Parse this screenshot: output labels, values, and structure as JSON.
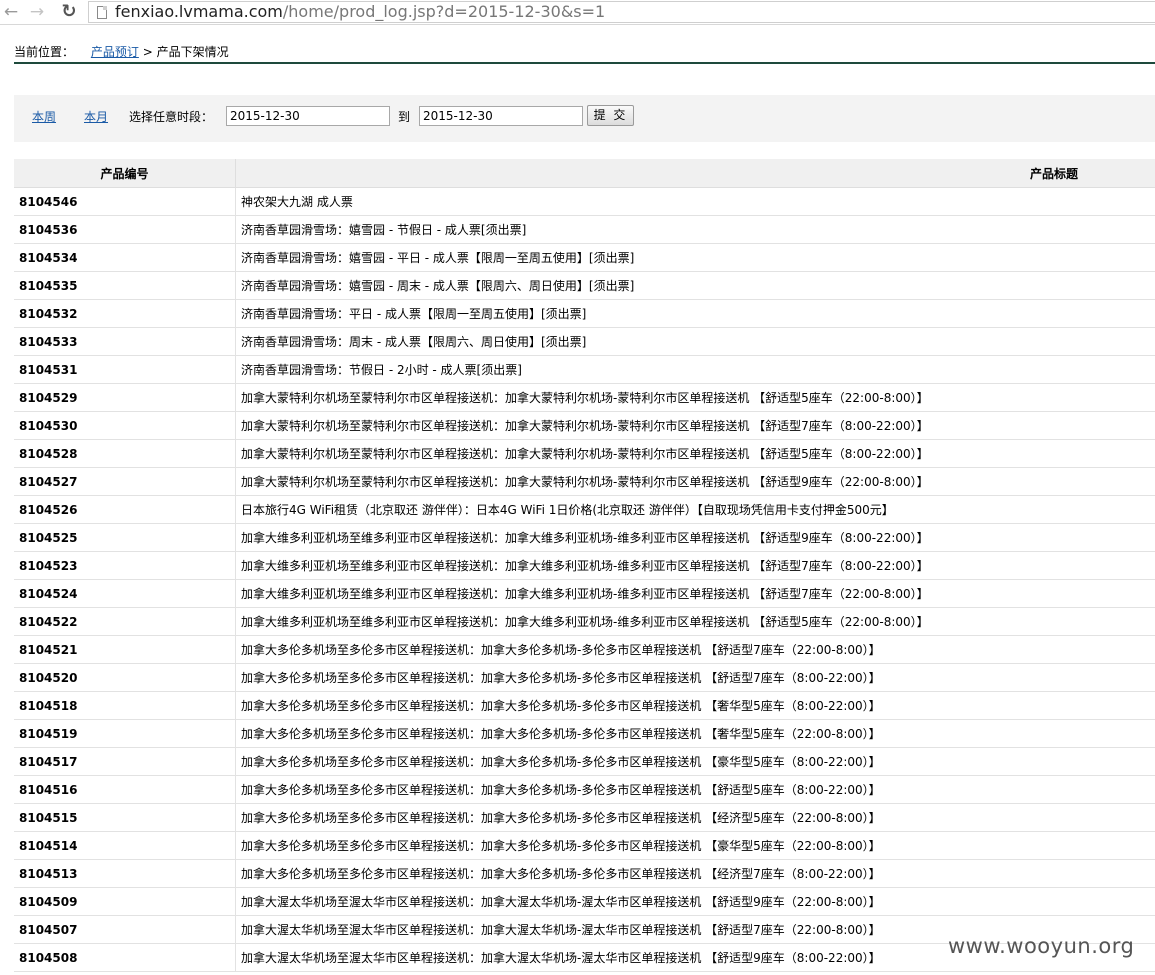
{
  "browser": {
    "url_host": "fenxiao.lvmama.com",
    "url_path": "/home/prod_log.jsp?d=2015-12-30&s=1"
  },
  "breadcrumb": {
    "label": "当前位置：",
    "link": "产品预订",
    "separator": ">",
    "current": "产品下架情况"
  },
  "filter": {
    "this_week": "本周",
    "this_month": "本月",
    "period_label": "选择任意时段：",
    "from_value": "2015-12-30",
    "to_label": "到",
    "to_value": "2015-12-30",
    "submit_label": "提 交"
  },
  "table": {
    "headers": {
      "id": "产品编号",
      "title": "产品标题"
    },
    "rows": [
      {
        "id": "8104546",
        "title": "神农架大九湖 成人票"
      },
      {
        "id": "8104536",
        "title": "济南香草园滑雪场：嬉雪园 - 节假日 - 成人票[须出票]"
      },
      {
        "id": "8104534",
        "title": "济南香草园滑雪场：嬉雪园 - 平日 - 成人票【限周一至周五使用】[须出票]"
      },
      {
        "id": "8104535",
        "title": "济南香草园滑雪场：嬉雪园 - 周末 - 成人票【限周六、周日使用】[须出票]"
      },
      {
        "id": "8104532",
        "title": "济南香草园滑雪场：平日 - 成人票【限周一至周五使用】[须出票]"
      },
      {
        "id": "8104533",
        "title": "济南香草园滑雪场：周末 - 成人票【限周六、周日使用】[须出票]"
      },
      {
        "id": "8104531",
        "title": "济南香草园滑雪场：节假日 - 2小时 - 成人票[须出票]"
      },
      {
        "id": "8104529",
        "title": "加拿大蒙特利尔机场至蒙特利尔市区单程接送机：加拿大蒙特利尔机场-蒙特利尔市区单程接送机 【舒适型5座车（22:00-8:00）】"
      },
      {
        "id": "8104530",
        "title": "加拿大蒙特利尔机场至蒙特利尔市区单程接送机：加拿大蒙特利尔机场-蒙特利尔市区单程接送机 【舒适型7座车（8:00-22:00）】"
      },
      {
        "id": "8104528",
        "title": "加拿大蒙特利尔机场至蒙特利尔市区单程接送机：加拿大蒙特利尔机场-蒙特利尔市区单程接送机 【舒适型5座车（8:00-22:00）】"
      },
      {
        "id": "8104527",
        "title": "加拿大蒙特利尔机场至蒙特利尔市区单程接送机：加拿大蒙特利尔机场-蒙特利尔市区单程接送机 【舒适型9座车（22:00-8:00）】"
      },
      {
        "id": "8104526",
        "title": "日本旅行4G WiFi租赁（北京取还 游伴伴）：日本4G WiFi 1日价格(北京取还 游伴伴）【自取现场凭信用卡支付押金500元】"
      },
      {
        "id": "8104525",
        "title": "加拿大维多利亚机场至维多利亚市区单程接送机：加拿大维多利亚机场-维多利亚市区单程接送机 【舒适型9座车（8:00-22:00）】"
      },
      {
        "id": "8104523",
        "title": "加拿大维多利亚机场至维多利亚市区单程接送机：加拿大维多利亚机场-维多利亚市区单程接送机 【舒适型7座车（8:00-22:00）】"
      },
      {
        "id": "8104524",
        "title": "加拿大维多利亚机场至维多利亚市区单程接送机：加拿大维多利亚机场-维多利亚市区单程接送机 【舒适型7座车（22:00-8:00）】"
      },
      {
        "id": "8104522",
        "title": "加拿大维多利亚机场至维多利亚市区单程接送机：加拿大维多利亚机场-维多利亚市区单程接送机 【舒适型5座车（22:00-8:00）】"
      },
      {
        "id": "8104521",
        "title": "加拿大多伦多机场至多伦多市区单程接送机：加拿大多伦多机场-多伦多市区单程接送机 【舒适型7座车（22:00-8:00）】"
      },
      {
        "id": "8104520",
        "title": "加拿大多伦多机场至多伦多市区单程接送机：加拿大多伦多机场-多伦多市区单程接送机 【舒适型7座车（8:00-22:00）】"
      },
      {
        "id": "8104518",
        "title": "加拿大多伦多机场至多伦多市区单程接送机：加拿大多伦多机场-多伦多市区单程接送机 【奢华型5座车（8:00-22:00）】"
      },
      {
        "id": "8104519",
        "title": "加拿大多伦多机场至多伦多市区单程接送机：加拿大多伦多机场-多伦多市区单程接送机 【奢华型5座车（22:00-8:00）】"
      },
      {
        "id": "8104517",
        "title": "加拿大多伦多机场至多伦多市区单程接送机：加拿大多伦多机场-多伦多市区单程接送机 【豪华型5座车（8:00-22:00）】"
      },
      {
        "id": "8104516",
        "title": "加拿大多伦多机场至多伦多市区单程接送机：加拿大多伦多机场-多伦多市区单程接送机 【舒适型5座车（8:00-22:00）】"
      },
      {
        "id": "8104515",
        "title": "加拿大多伦多机场至多伦多市区单程接送机：加拿大多伦多机场-多伦多市区单程接送机 【经济型5座车（22:00-8:00）】"
      },
      {
        "id": "8104514",
        "title": "加拿大多伦多机场至多伦多市区单程接送机：加拿大多伦多机场-多伦多市区单程接送机 【豪华型5座车（22:00-8:00）】"
      },
      {
        "id": "8104513",
        "title": "加拿大多伦多机场至多伦多市区单程接送机：加拿大多伦多机场-多伦多市区单程接送机 【经济型7座车（8:00-22:00）】"
      },
      {
        "id": "8104509",
        "title": "加拿大渥太华机场至渥太华市区单程接送机：加拿大渥太华机场-渥太华市区单程接送机 【舒适型9座车（22:00-8:00）】"
      },
      {
        "id": "8104507",
        "title": "加拿大渥太华机场至渥太华市区单程接送机：加拿大渥太华机场-渥太华市区单程接送机 【舒适型7座车（22:00-8:00）】"
      },
      {
        "id": "8104508",
        "title": "加拿大渥太华机场至渥太华市区单程接送机：加拿大渥太华机场-渥太华市区单程接送机 【舒适型9座车（8:00-22:00）】"
      }
    ]
  },
  "watermark": "www.wooyun.org"
}
